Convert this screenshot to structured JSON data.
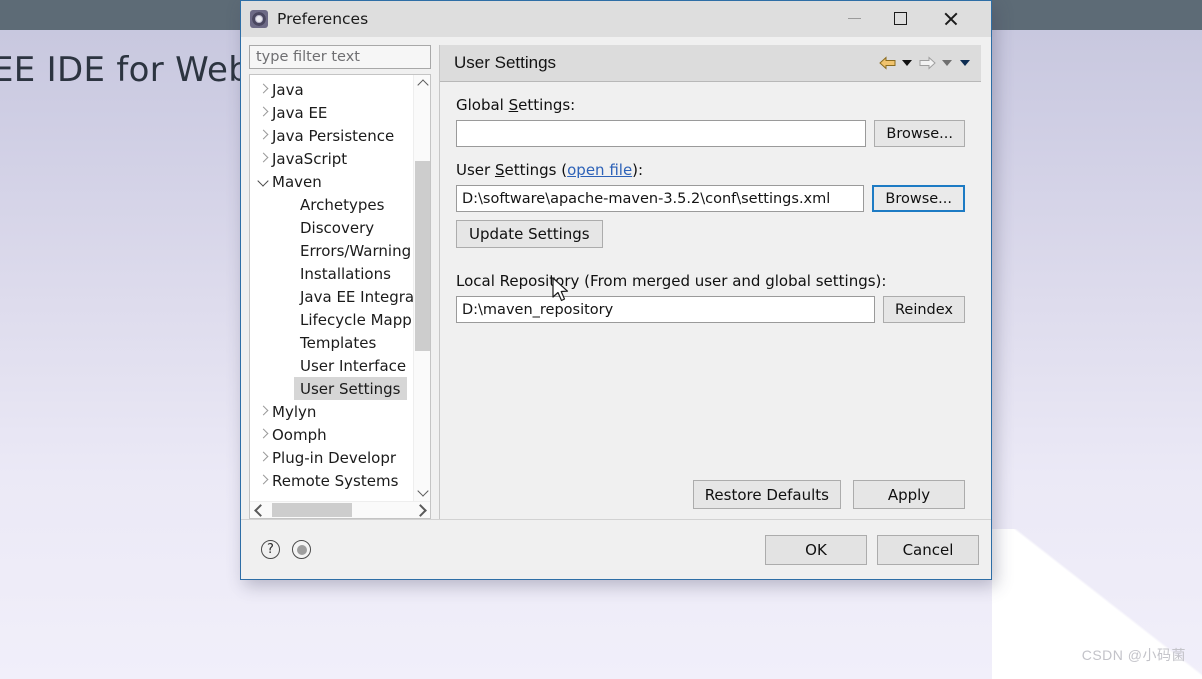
{
  "background": {
    "splash_text": "EE IDE for Web D",
    "watermark": "CSDN @小码菌"
  },
  "dialog": {
    "title": "Preferences",
    "icon": "preferences-gear-icon",
    "window_controls": {
      "minimize": "minimize-icon",
      "maximize": "maximize-icon",
      "close": "close-icon"
    }
  },
  "filter": {
    "placeholder": "type filter text",
    "value": ""
  },
  "tree": {
    "items": [
      {
        "label": "Java",
        "level": 0,
        "state": "collapsed",
        "selected": false
      },
      {
        "label": "Java EE",
        "level": 0,
        "state": "collapsed",
        "selected": false
      },
      {
        "label": "Java Persistence",
        "level": 0,
        "state": "collapsed",
        "selected": false
      },
      {
        "label": "JavaScript",
        "level": 0,
        "state": "collapsed",
        "selected": false
      },
      {
        "label": "Maven",
        "level": 0,
        "state": "expanded",
        "selected": false
      },
      {
        "label": "Archetypes",
        "level": 1,
        "state": "leaf",
        "selected": false
      },
      {
        "label": "Discovery",
        "level": 1,
        "state": "leaf",
        "selected": false
      },
      {
        "label": "Errors/Warning",
        "level": 1,
        "state": "leaf",
        "selected": false
      },
      {
        "label": "Installations",
        "level": 1,
        "state": "leaf",
        "selected": false
      },
      {
        "label": "Java EE Integra",
        "level": 1,
        "state": "leaf",
        "selected": false
      },
      {
        "label": "Lifecycle Mapp",
        "level": 1,
        "state": "leaf",
        "selected": false
      },
      {
        "label": "Templates",
        "level": 1,
        "state": "leaf",
        "selected": false
      },
      {
        "label": "User Interface",
        "level": 1,
        "state": "leaf",
        "selected": false
      },
      {
        "label": "User Settings",
        "level": 1,
        "state": "leaf",
        "selected": true
      },
      {
        "label": "Mylyn",
        "level": 0,
        "state": "collapsed",
        "selected": false
      },
      {
        "label": "Oomph",
        "level": 0,
        "state": "collapsed",
        "selected": false
      },
      {
        "label": "Plug-in Developr",
        "level": 0,
        "state": "collapsed",
        "selected": false
      },
      {
        "label": "Remote Systems",
        "level": 0,
        "state": "collapsed",
        "selected": false
      }
    ]
  },
  "pane": {
    "title": "User Settings",
    "nav": {
      "back": "back-arrow-icon",
      "back_menu": "back-dropdown-icon",
      "forward": "forward-arrow-icon",
      "forward_menu": "forward-dropdown-icon",
      "view_menu": "view-menu-icon"
    },
    "global_settings": {
      "label_pre": "Global ",
      "label_accel": "S",
      "label_post": "ettings:",
      "value": "",
      "browse_label": "Browse..."
    },
    "user_settings": {
      "label_pre": "User ",
      "label_accel": "S",
      "label_mid": "ettings (",
      "link": "open file",
      "label_post": "):",
      "value": "D:\\software\\apache-maven-3.5.2\\conf\\settings.xml",
      "browse_label": "Browse..."
    },
    "update_settings_label": "Update Settings",
    "local_repository": {
      "label": "Local Repository (From merged user and global settings):",
      "value": "D:\\maven_repository",
      "reindex_label": "Reindex"
    },
    "restore_defaults_label": "Restore Defaults",
    "apply_label": "Apply"
  },
  "footer": {
    "help_icon": "?",
    "help_icon_name": "help-icon",
    "extra_icon_name": "status-circle-icon",
    "ok_label": "OK",
    "cancel_label": "Cancel"
  },
  "colors": {
    "accent": "#2e6ea6",
    "focus_border": "#1d7bc4",
    "link": "#2d62b8",
    "selection": "#d6d6d6",
    "titlebar_topstrip": "#5d6b76"
  }
}
